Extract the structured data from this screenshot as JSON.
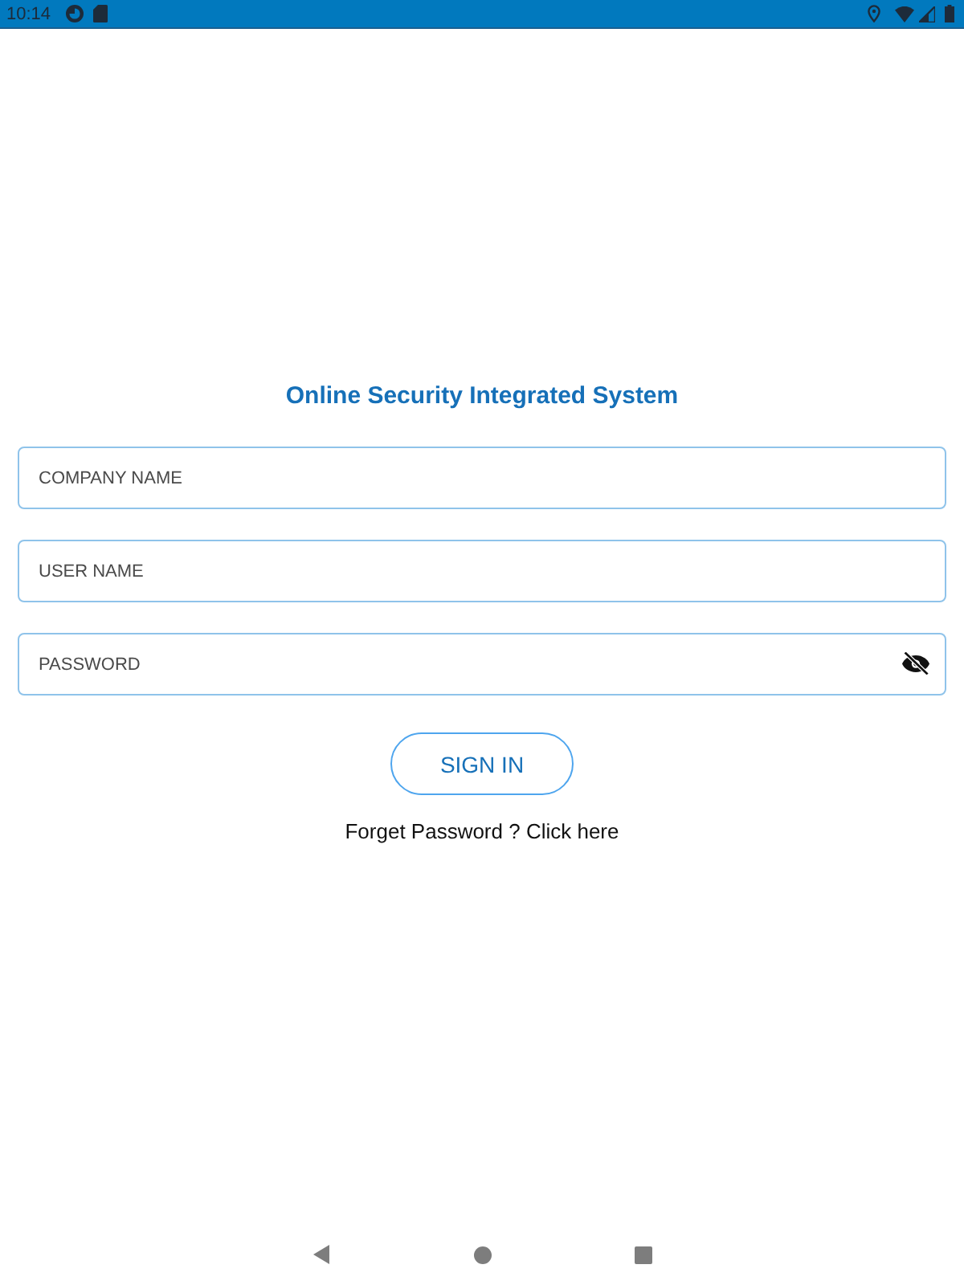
{
  "status_bar": {
    "time": "10:14"
  },
  "title": "Online Security Integrated System",
  "fields": [
    {
      "kind": "text",
      "placeholder": "COMPANY NAME"
    },
    {
      "kind": "text",
      "placeholder": "USER NAME"
    },
    {
      "kind": "password",
      "placeholder": "PASSWORD",
      "revealed": false
    }
  ],
  "sign_in_button": "SIGN IN",
  "forgot_link": "Forget Password ? Click here"
}
